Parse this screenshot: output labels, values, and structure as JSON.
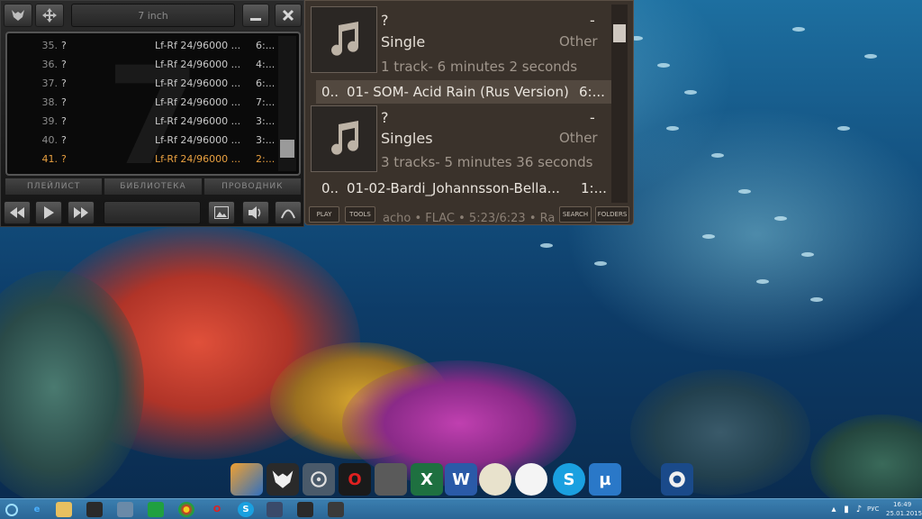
{
  "player": {
    "title_field": "7 inch",
    "playlist": [
      {
        "num": "35.",
        "title": "?",
        "format": "Lf-Rf 24/96000 ...",
        "duration": "6:..."
      },
      {
        "num": "36.",
        "title": "?",
        "format": "Lf-Rf 24/96000 ...",
        "duration": "4:..."
      },
      {
        "num": "37.",
        "title": "?",
        "format": "Lf-Rf 24/96000 ...",
        "duration": "6:..."
      },
      {
        "num": "38.",
        "title": "?",
        "format": "Lf-Rf 24/96000 ...",
        "duration": "7:..."
      },
      {
        "num": "39.",
        "title": "?",
        "format": "Lf-Rf 24/96000 ...",
        "duration": "3:..."
      },
      {
        "num": "40.",
        "title": "?",
        "format": "Lf-Rf 24/96000 ...",
        "duration": "3:..."
      },
      {
        "num": "41.",
        "title": "?",
        "format": "Lf-Rf 24/96000 ...",
        "duration": "2:..."
      }
    ],
    "tabs": [
      "ПЛЕЙЛИСТ",
      "БИБЛИОТЕКА",
      "ПРОВОДНИК"
    ],
    "active_row_color": "#e8a040"
  },
  "library": {
    "albums": [
      {
        "artist": "?",
        "dash": "-",
        "album": "Single",
        "genre": "Other",
        "summary": "1 track- 6 minutes 2 seconds",
        "track_num": "0..",
        "track_title": "01- SOM- Acid Rain (Rus Version)",
        "track_dur": "6:..."
      },
      {
        "artist": "?",
        "dash": "-",
        "album": "Singles",
        "genre": "Other",
        "summary": "3 tracks- 5 minutes 36 seconds",
        "track_num": "0..",
        "track_title": "01-02-Bardi_Johannsson-Bella...",
        "track_dur": "1:..."
      }
    ],
    "buttons": {
      "play": "PLAY",
      "tools": "TOOLS",
      "search": "SEARCH",
      "folders": "FOLDERS"
    },
    "ticker": "acho • FLAC • 5:23/6:23 • Ra"
  },
  "taskbar": {
    "lang": "РУС",
    "time": "16:49",
    "date": "25.01.2015"
  }
}
